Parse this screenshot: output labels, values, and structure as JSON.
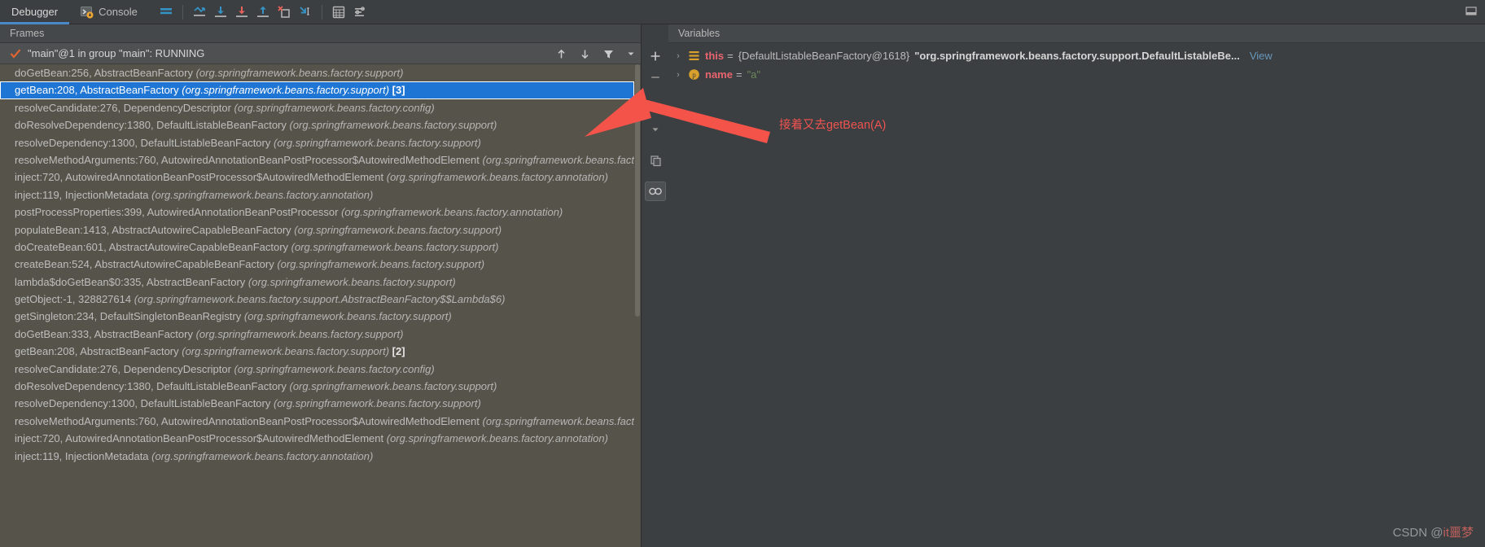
{
  "toolbar": {
    "tabs": [
      {
        "label": "Debugger",
        "icon": "bug-icon",
        "active": true
      },
      {
        "label": "Console",
        "icon": "console-icon",
        "active": false
      }
    ],
    "buttons": [
      {
        "name": "layout-settings-icon",
        "title": "Layout Settings"
      },
      {
        "name": "show-execution-point-icon",
        "title": "Show Execution Point"
      },
      {
        "name": "step-over-icon",
        "title": "Step Over"
      },
      {
        "name": "step-into-icon",
        "title": "Step Into"
      },
      {
        "name": "step-out-icon",
        "title": "Step Out"
      },
      {
        "name": "force-step-into-icon",
        "title": "Force Step Into"
      },
      {
        "name": "drop-frame-icon",
        "title": "Drop Frame"
      },
      {
        "name": "evaluate-expression-icon",
        "title": "Evaluate Expression"
      },
      {
        "name": "settings-icon",
        "title": "Settings"
      }
    ],
    "collapse_label": "hide-icon"
  },
  "frames": {
    "title": "Frames",
    "thread": {
      "status_icon": "check-icon",
      "label": "\"main\"@1 in group \"main\": RUNNING"
    },
    "thread_controls": [
      {
        "name": "move-up-icon",
        "glyph": "↑"
      },
      {
        "name": "move-down-icon",
        "glyph": "↓"
      },
      {
        "name": "filter-icon",
        "glyph": "▼"
      },
      {
        "name": "dropdown-icon",
        "glyph": "▾"
      }
    ],
    "items": [
      {
        "method": "doGetBean:256, AbstractBeanFactory ",
        "pkg": "(org.springframework.beans.factory.support)",
        "count": "",
        "selected": false
      },
      {
        "method": "getBean:208, AbstractBeanFactory ",
        "pkg": "(org.springframework.beans.factory.support)",
        "count": " [3]",
        "selected": true
      },
      {
        "method": "resolveCandidate:276, DependencyDescriptor ",
        "pkg": "(org.springframework.beans.factory.config)",
        "count": "",
        "selected": false
      },
      {
        "method": "doResolveDependency:1380, DefaultListableBeanFactory ",
        "pkg": "(org.springframework.beans.factory.support)",
        "count": "",
        "selected": false
      },
      {
        "method": "resolveDependency:1300, DefaultListableBeanFactory ",
        "pkg": "(org.springframework.beans.factory.support)",
        "count": "",
        "selected": false
      },
      {
        "method": "resolveMethodArguments:760, AutowiredAnnotationBeanPostProcessor$AutowiredMethodElement ",
        "pkg": "(org.springframework.beans.factory.annotation)",
        "count": "",
        "selected": false
      },
      {
        "method": "inject:720, AutowiredAnnotationBeanPostProcessor$AutowiredMethodElement ",
        "pkg": "(org.springframework.beans.factory.annotation)",
        "count": "",
        "selected": false
      },
      {
        "method": "inject:119, InjectionMetadata ",
        "pkg": "(org.springframework.beans.factory.annotation)",
        "count": "",
        "selected": false
      },
      {
        "method": "postProcessProperties:399, AutowiredAnnotationBeanPostProcessor ",
        "pkg": "(org.springframework.beans.factory.annotation)",
        "count": "",
        "selected": false
      },
      {
        "method": "populateBean:1413, AbstractAutowireCapableBeanFactory ",
        "pkg": "(org.springframework.beans.factory.support)",
        "count": "",
        "selected": false
      },
      {
        "method": "doCreateBean:601, AbstractAutowireCapableBeanFactory ",
        "pkg": "(org.springframework.beans.factory.support)",
        "count": "",
        "selected": false
      },
      {
        "method": "createBean:524, AbstractAutowireCapableBeanFactory ",
        "pkg": "(org.springframework.beans.factory.support)",
        "count": "",
        "selected": false
      },
      {
        "method": "lambda$doGetBean$0:335, AbstractBeanFactory ",
        "pkg": "(org.springframework.beans.factory.support)",
        "count": "",
        "selected": false
      },
      {
        "method": "getObject:-1, 328827614 ",
        "pkg": "(org.springframework.beans.factory.support.AbstractBeanFactory$$Lambda$6)",
        "count": "",
        "selected": false
      },
      {
        "method": "getSingleton:234, DefaultSingletonBeanRegistry ",
        "pkg": "(org.springframework.beans.factory.support)",
        "count": "",
        "selected": false
      },
      {
        "method": "doGetBean:333, AbstractBeanFactory ",
        "pkg": "(org.springframework.beans.factory.support)",
        "count": "",
        "selected": false
      },
      {
        "method": "getBean:208, AbstractBeanFactory ",
        "pkg": "(org.springframework.beans.factory.support)",
        "count": " [2]",
        "selected": false
      },
      {
        "method": "resolveCandidate:276, DependencyDescriptor ",
        "pkg": "(org.springframework.beans.factory.config)",
        "count": "",
        "selected": false
      },
      {
        "method": "doResolveDependency:1380, DefaultListableBeanFactory ",
        "pkg": "(org.springframework.beans.factory.support)",
        "count": "",
        "selected": false
      },
      {
        "method": "resolveDependency:1300, DefaultListableBeanFactory ",
        "pkg": "(org.springframework.beans.factory.support)",
        "count": "",
        "selected": false
      },
      {
        "method": "resolveMethodArguments:760, AutowiredAnnotationBeanPostProcessor$AutowiredMethodElement ",
        "pkg": "(org.springframework.beans.factory.annotation)",
        "count": "",
        "selected": false
      },
      {
        "method": "inject:720, AutowiredAnnotationBeanPostProcessor$AutowiredMethodElement ",
        "pkg": "(org.springframework.beans.factory.annotation)",
        "count": "",
        "selected": false
      },
      {
        "method": "inject:119, InjectionMetadata ",
        "pkg": "(org.springframework.beans.factory.annotation)",
        "count": "",
        "selected": false
      }
    ]
  },
  "vars_toolbar": [
    {
      "name": "add-watch-button",
      "glyph": "+"
    },
    {
      "name": "remove-watch-button",
      "glyph": "−"
    },
    {
      "name": "watch-up-button",
      "glyph": "▲"
    },
    {
      "name": "watch-down-button",
      "glyph": "▼"
    },
    {
      "name": "copy-value-button",
      "glyph": "⧉"
    },
    {
      "name": "watches-button",
      "glyph": "∞"
    }
  ],
  "variables": {
    "title": "Variables",
    "rows": [
      {
        "chevron": "›",
        "icon": "field-icon",
        "icon_kind": "object",
        "name": "this",
        "eq": " = ",
        "value_obj": "{DefaultListableBeanFactory@1618} ",
        "value_str": "\"org.springframework.beans.factory.support.DefaultListableBe...",
        "link": "View"
      },
      {
        "chevron": "›",
        "icon": "parameter-icon",
        "icon_kind": "param",
        "name": "name",
        "eq": " = ",
        "value_obj": "",
        "value_str": "\"a\"",
        "link": ""
      }
    ]
  },
  "annotation": {
    "text": "接着又去getBean(A)",
    "color": "#ef5350"
  },
  "watermark": {
    "prefix": "CSDN @",
    "suffix": "it噩梦"
  },
  "colors": {
    "accent": "#4a88c7",
    "selection": "#1f75d3",
    "frames_bg": "#56544a",
    "panel_bg": "#3c3f41",
    "annotation": "#ef5350",
    "var_name": "#e8656f",
    "string": "#6a8759",
    "link": "#6897bb"
  }
}
